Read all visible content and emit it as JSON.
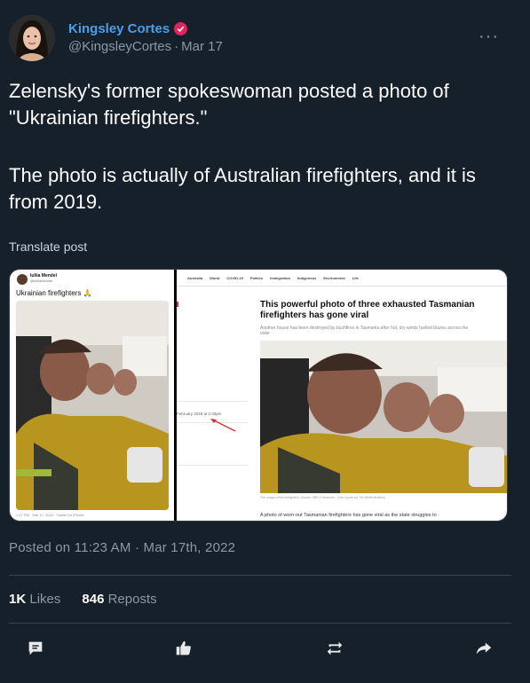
{
  "author": {
    "display_name": "Kingsley Cortes",
    "handle": "@KingsleyCortes",
    "date": "Mar 17",
    "verified_icon": "verified-badge-icon"
  },
  "post": {
    "paragraph_1": "Zelensky's former spokeswoman posted a photo of \"Ukrainian firefighters.\"",
    "paragraph_2": "The photo is actually of Australian firefighters, and it is from 2019.",
    "translate_label": "Translate post",
    "more_label": "···"
  },
  "media": {
    "left": {
      "name": "Iuliia Mendel",
      "handle": "@IuliiaMendel",
      "text": "Ukrainian firefighters 🙏",
      "footer": "1:17 PM · Mar 17, 2022 · Twitter for iPhone"
    },
    "right": {
      "nav": [
        "Australia",
        "World",
        "COVID-19",
        "Politics",
        "Immigration",
        "Indigenous",
        "Environment",
        "Life"
      ],
      "headline": "This powerful photo of three exhausted Tasmanian firefighters has gone viral",
      "subheading": "Another house has been destroyed by bushfires in Tasmania after hot, dry winds fuelled blazes across the state",
      "date": "February 2019 at 2:30pm",
      "caption": "The image of the firefighters. Source: SBS | Facebook - John Lyons via The Wolfe Brothers",
      "body": "A photo of worn-out Tasmanian firefighters has gone viral as the state struggles to"
    }
  },
  "timestamp": "Posted on 11:23 AM · Mar 17th, 2022",
  "stats": {
    "likes_count": "1K",
    "likes_label": "Likes",
    "reposts_count": "846",
    "reposts_label": "Reposts"
  },
  "actions": [
    "reply-icon",
    "like-icon",
    "repost-icon",
    "share-icon"
  ],
  "colors": {
    "background": "#15202b",
    "link_blue": "#4a9fe8",
    "verified_red": "#e0245e",
    "muted": "#8b98a5"
  }
}
